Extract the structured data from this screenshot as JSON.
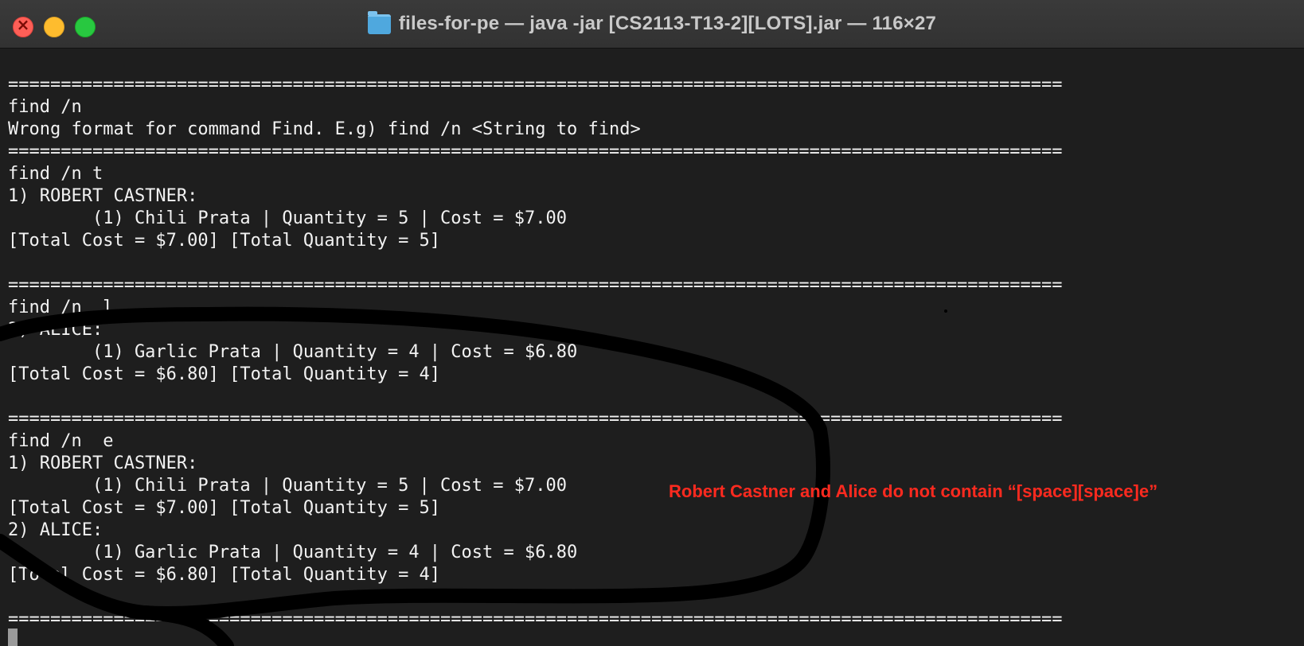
{
  "window": {
    "title": "files-for-pe — java -jar [CS2113-T13-2][LOTS].jar — 116×27"
  },
  "icons": {
    "title_icon": "folder-icon"
  },
  "terminal_lines": [
    "====================================================================================================",
    "find /n",
    "Wrong format for command Find. E.g) find /n <String to find>",
    "====================================================================================================",
    "find /n t",
    "1) ROBERT CASTNER:",
    "        (1) Chili Prata | Quantity = 5 | Cost = $7.00",
    "[Total Cost = $7.00] [Total Quantity = 5]",
    "",
    "====================================================================================================",
    "find /n  l",
    "2) ALICE:",
    "        (1) Garlic Prata | Quantity = 4 | Cost = $6.80",
    "[Total Cost = $6.80] [Total Quantity = 4]",
    "",
    "====================================================================================================",
    "find /n  e",
    "1) ROBERT CASTNER:",
    "        (1) Chili Prata | Quantity = 5 | Cost = $7.00",
    "[Total Cost = $7.00] [Total Quantity = 5]",
    "2) ALICE:",
    "        (1) Garlic Prata | Quantity = 4 | Cost = $6.80",
    "[Total Cost = $6.80] [Total Quantity = 4]",
    "",
    "===================================================================================================="
  ],
  "annotation": {
    "text": "Robert Castner and Alice do not contain “[space][space]e”",
    "color": "#ff2a1f"
  },
  "colors": {
    "terminal_bg": "#1e1e1e",
    "terminal_fg": "#f2f2f2",
    "close": "#fe5f57",
    "minimize": "#febc2e",
    "maximize": "#28c840"
  }
}
